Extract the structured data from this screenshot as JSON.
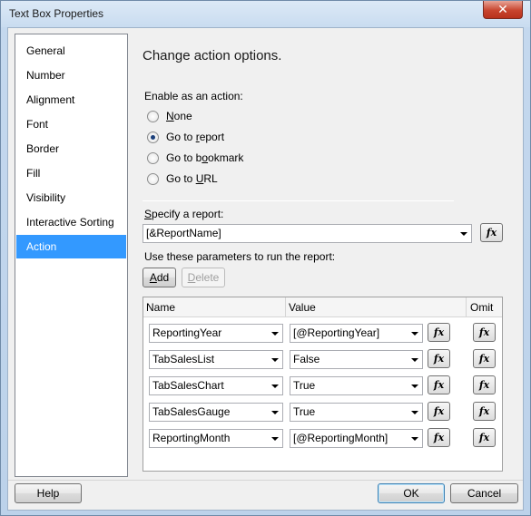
{
  "window": {
    "title": "Text Box Properties",
    "close_glyph": "✕"
  },
  "sidebar": {
    "items": [
      {
        "label": "General"
      },
      {
        "label": "Number"
      },
      {
        "label": "Alignment"
      },
      {
        "label": "Font"
      },
      {
        "label": "Border"
      },
      {
        "label": "Fill"
      },
      {
        "label": "Visibility"
      },
      {
        "label": "Interactive Sorting"
      },
      {
        "label": "Action",
        "selected": true
      }
    ]
  },
  "panel": {
    "heading": "Change action options.",
    "enable_label": "Enable as an action:",
    "radios": [
      {
        "label_pre": "",
        "label_u": "N",
        "label_post": "one",
        "checked": false
      },
      {
        "label_pre": "Go to ",
        "label_u": "r",
        "label_post": "eport",
        "checked": true
      },
      {
        "label_pre": "Go to b",
        "label_u": "o",
        "label_post": "okmark",
        "checked": false
      },
      {
        "label_pre": "Go to ",
        "label_u": "U",
        "label_post": "RL",
        "checked": false
      }
    ],
    "specify_label_u": "S",
    "specify_label_post": "pecify a report:",
    "report_value": "[&ReportName]",
    "fx_label": "fx",
    "params_label": "Use these parameters to run the report:",
    "add_label_u": "A",
    "add_label_post": "dd",
    "delete_label_u": "D",
    "delete_label_post": "elete",
    "grid": {
      "headers": {
        "name": "Name",
        "value": "Value",
        "omit": "Omit"
      },
      "rows": [
        {
          "name": "ReportingYear",
          "value": "[@ReportingYear]"
        },
        {
          "name": "TabSalesList",
          "value": "False"
        },
        {
          "name": "TabSalesChart",
          "value": "True"
        },
        {
          "name": "TabSalesGauge",
          "value": "True"
        },
        {
          "name": "ReportingMonth",
          "value": "[@ReportingMonth]"
        }
      ]
    }
  },
  "footer": {
    "help": "Help",
    "ok": "OK",
    "cancel": "Cancel"
  }
}
